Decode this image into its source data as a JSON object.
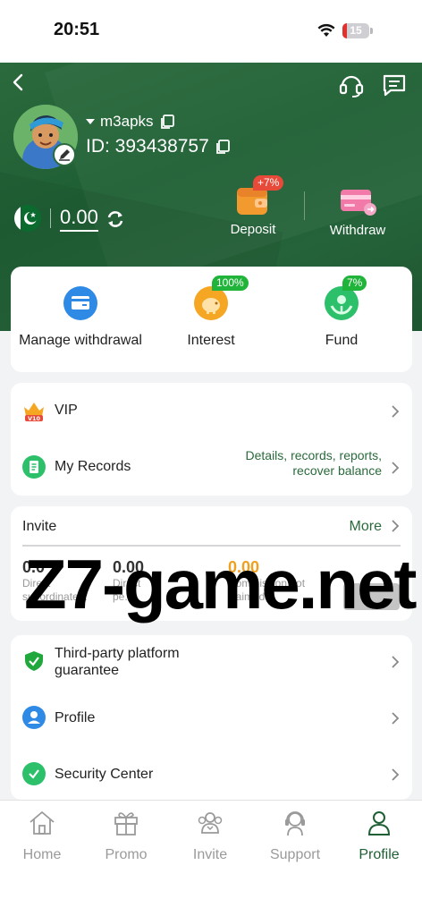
{
  "status": {
    "time": "20:51",
    "battery": "15"
  },
  "header": {
    "username": "m3apks",
    "id_label": "ID: 393438757",
    "balance": "0.00",
    "deposit_label": "Deposit",
    "deposit_badge": "+7%",
    "withdraw_label": "Withdraw"
  },
  "quick": {
    "items": [
      {
        "label": "Manage withdrawal",
        "badge": ""
      },
      {
        "label": "Interest",
        "badge": "100%"
      },
      {
        "label": "Fund",
        "badge": "7%"
      }
    ]
  },
  "menu1": {
    "vip_label": "VIP",
    "vip_badge": "V10",
    "records_label": "My Records",
    "records_detail_1": "Details, records, reports,",
    "records_detail_2": "recover balance"
  },
  "invite": {
    "title": "Invite",
    "more": "More",
    "stats": [
      {
        "value": "0.0",
        "label_1": "Direct",
        "label_2": "subordinate..."
      },
      {
        "value": "0.00",
        "label_1": "Direct",
        "label_2": "pe..."
      },
      {
        "value": "0.00",
        "label_1": "Commission not",
        "label_2": "claimed"
      }
    ]
  },
  "watermark": "Z7-game.net",
  "menu2": {
    "guarantee_line1": "Third-party platform",
    "guarantee_line2": "guarantee",
    "profile_label": "Profile",
    "security_label": "Security Center"
  },
  "tabs": [
    {
      "label": "Home",
      "active": false
    },
    {
      "label": "Promo",
      "active": false
    },
    {
      "label": "Invite",
      "active": false
    },
    {
      "label": "Support",
      "active": false
    },
    {
      "label": "Profile",
      "active": true
    }
  ],
  "colors": {
    "brand_green": "#1f5f34",
    "link_green": "#2a6a3c",
    "accent_orange": "#f0a020",
    "badge_red": "#e84a3a",
    "badge_green": "#21b43a"
  }
}
